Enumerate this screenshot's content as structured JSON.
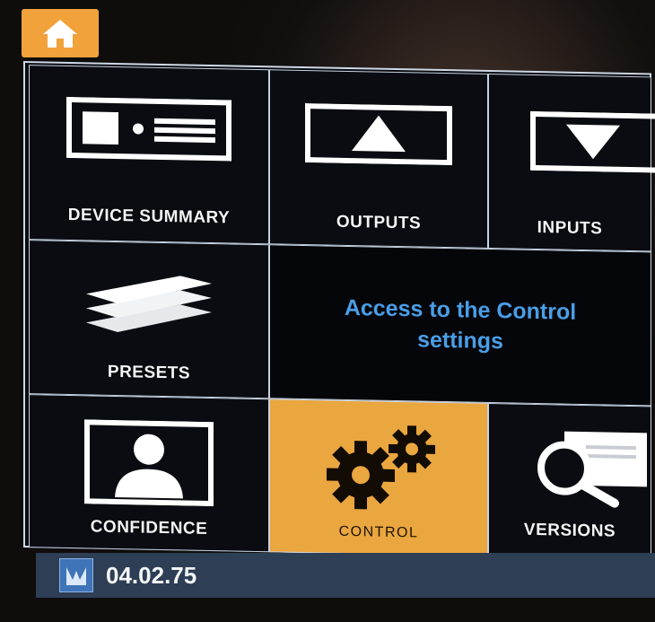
{
  "home": {
    "icon": "home-icon"
  },
  "tiles": {
    "device_summary": {
      "label": "DEVICE SUMMARY",
      "icon": "device-icon"
    },
    "outputs": {
      "label": "OUTPUTS",
      "icon": "up-arrow-icon"
    },
    "inputs": {
      "label": "INPUTS",
      "icon": "down-arrow-icon"
    },
    "presets": {
      "label": "PRESETS",
      "icon": "layers-icon"
    },
    "confidence": {
      "label": "CONFIDENCE",
      "icon": "person-monitor-icon"
    },
    "control": {
      "label": "CONTROL",
      "icon": "gears-icon"
    },
    "versions": {
      "label": "VERSIONS",
      "icon": "magnifier-icon"
    }
  },
  "info": {
    "text": "Access to the Control settings"
  },
  "status": {
    "icon": "network-icon",
    "value": "04.02.75"
  },
  "colors": {
    "accent": "#eaa63f",
    "info_text": "#4a9ee6",
    "status_bar": "#2d3e55",
    "border": "#c7d3e2"
  }
}
